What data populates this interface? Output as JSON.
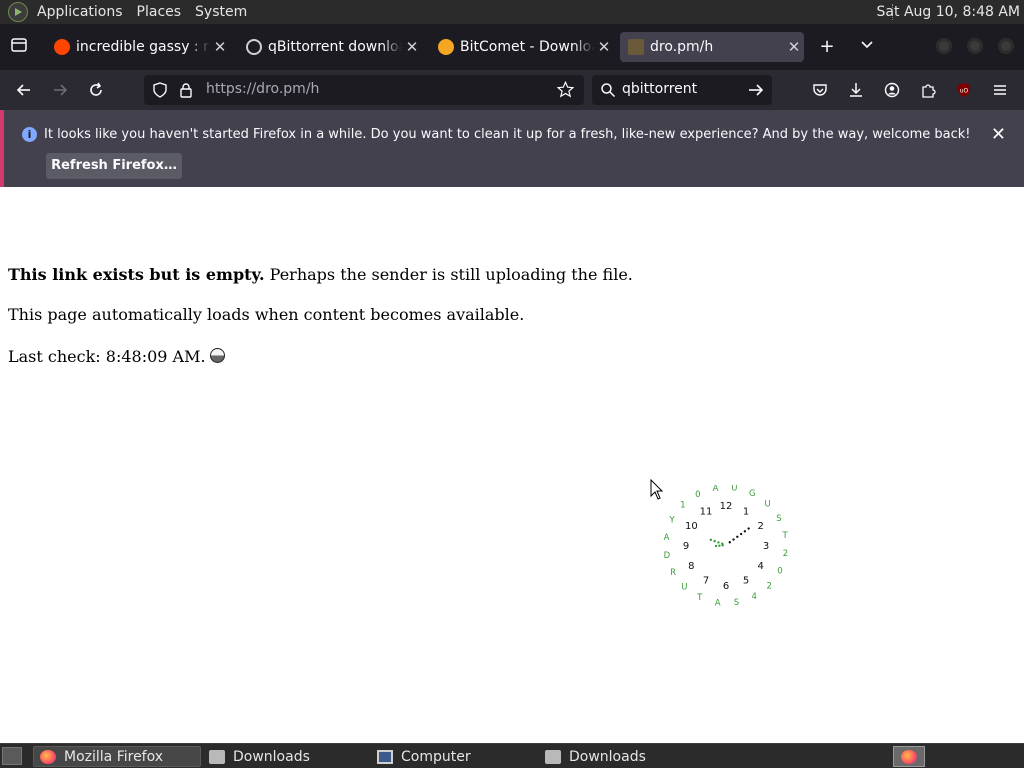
{
  "top_panel": {
    "menus": [
      "Applications",
      "Places",
      "System"
    ],
    "clock": "Sat Aug 10,  8:48 AM"
  },
  "tabs": [
    {
      "title": "incredible gassy : r/Gas",
      "icon": "reddit-icon",
      "active": false
    },
    {
      "title": "qBittorrent download fo",
      "icon": "qbittorrent-icon",
      "active": false
    },
    {
      "title": "BitComet - Download",
      "icon": "bitcomet-icon",
      "active": false
    },
    {
      "title": "dro.pm/h",
      "icon": "dropm-icon",
      "active": true
    }
  ],
  "urlbar": {
    "host": "https://dro.pm",
    "path": "/h"
  },
  "searchbar": {
    "query": "qbittorrent"
  },
  "notification": {
    "message": "It looks like you haven't started Firefox in a while. Do you want to clean it up for a fresh, like-new experience? And by the way, welcome back!",
    "button": "Refresh Firefox…"
  },
  "page": {
    "line1_bold": "This link exists but is empty.",
    "line1_rest": " Perhaps the sender is still uploading the file.",
    "line2": "This page automatically loads when content becomes available.",
    "line3": "Last check: 8:48:09 AM."
  },
  "clock_widget": {
    "numbers": [
      "12",
      "1",
      "2",
      "3",
      "4",
      "5",
      "6",
      "7",
      "8",
      "9",
      "10",
      "11"
    ],
    "ring_text": "AUGUST 2024 SATURDAY 10",
    "hour": 8,
    "minute": 48,
    "second": 9,
    "color": "#3a9a3a"
  },
  "taskbar": [
    {
      "label": "Mozilla Firefox",
      "icon": "firefox-icon",
      "active": true
    },
    {
      "label": "Downloads",
      "icon": "folder-icon",
      "active": false
    },
    {
      "label": "Computer",
      "icon": "computer-icon",
      "active": false
    },
    {
      "label": "Downloads",
      "icon": "folder-icon",
      "active": false
    }
  ],
  "colors": {
    "accent": "#d03a6e",
    "chrome_dark": "#1c1b22",
    "toolbar": "#2b2a33"
  }
}
